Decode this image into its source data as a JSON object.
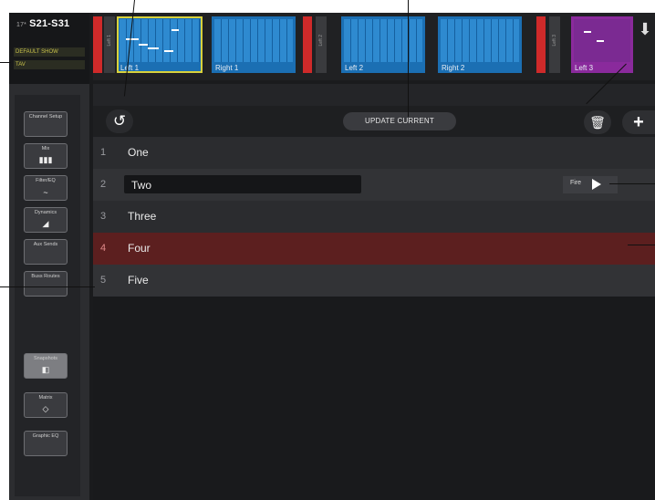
{
  "header": {
    "title": "S21-S31",
    "prefix": "17*",
    "sub1": "DEFAULT SHOW",
    "sub2": "TAV"
  },
  "strip": {
    "channels": [
      {
        "label": "Left 1",
        "selected": true
      },
      {
        "label": "Right 1",
        "selected": false
      },
      {
        "label": "Left 2",
        "selected": false
      },
      {
        "label": "Right 2",
        "selected": false
      },
      {
        "label": "Left 3",
        "selected": false
      }
    ],
    "grip_labels": [
      "Left 1",
      "Left 2",
      "Left 3"
    ]
  },
  "sidebar": {
    "items": [
      {
        "label": "Channel Setup",
        "icon": ""
      },
      {
        "label": "Mix",
        "icon": "▮▮▮"
      },
      {
        "label": "Filter/EQ",
        "icon": "~"
      },
      {
        "label": "Dynamics",
        "icon": "◢"
      },
      {
        "label": "Aux Sends",
        "icon": ""
      },
      {
        "label": "Buss Routes",
        "icon": ""
      },
      {
        "label": "Snapshots",
        "icon": "◧"
      },
      {
        "label": "Matrix",
        "icon": "◇"
      },
      {
        "label": "Graphic EQ",
        "icon": ""
      }
    ]
  },
  "toolbar": {
    "update_label": "UPDATE CURRENT"
  },
  "snapshots": [
    {
      "num": "1",
      "name": "One"
    },
    {
      "num": "2",
      "name": "Two"
    },
    {
      "num": "3",
      "name": "Three"
    },
    {
      "num": "4",
      "name": "Four"
    },
    {
      "num": "5",
      "name": "Five"
    }
  ],
  "fire_label": "Fire",
  "colors": {
    "accent_red": "#cf2a2a",
    "channel_blue": "#1b6fb3",
    "highlight_row": "#5c1f1f",
    "selection_outline": "#d9d23c"
  }
}
